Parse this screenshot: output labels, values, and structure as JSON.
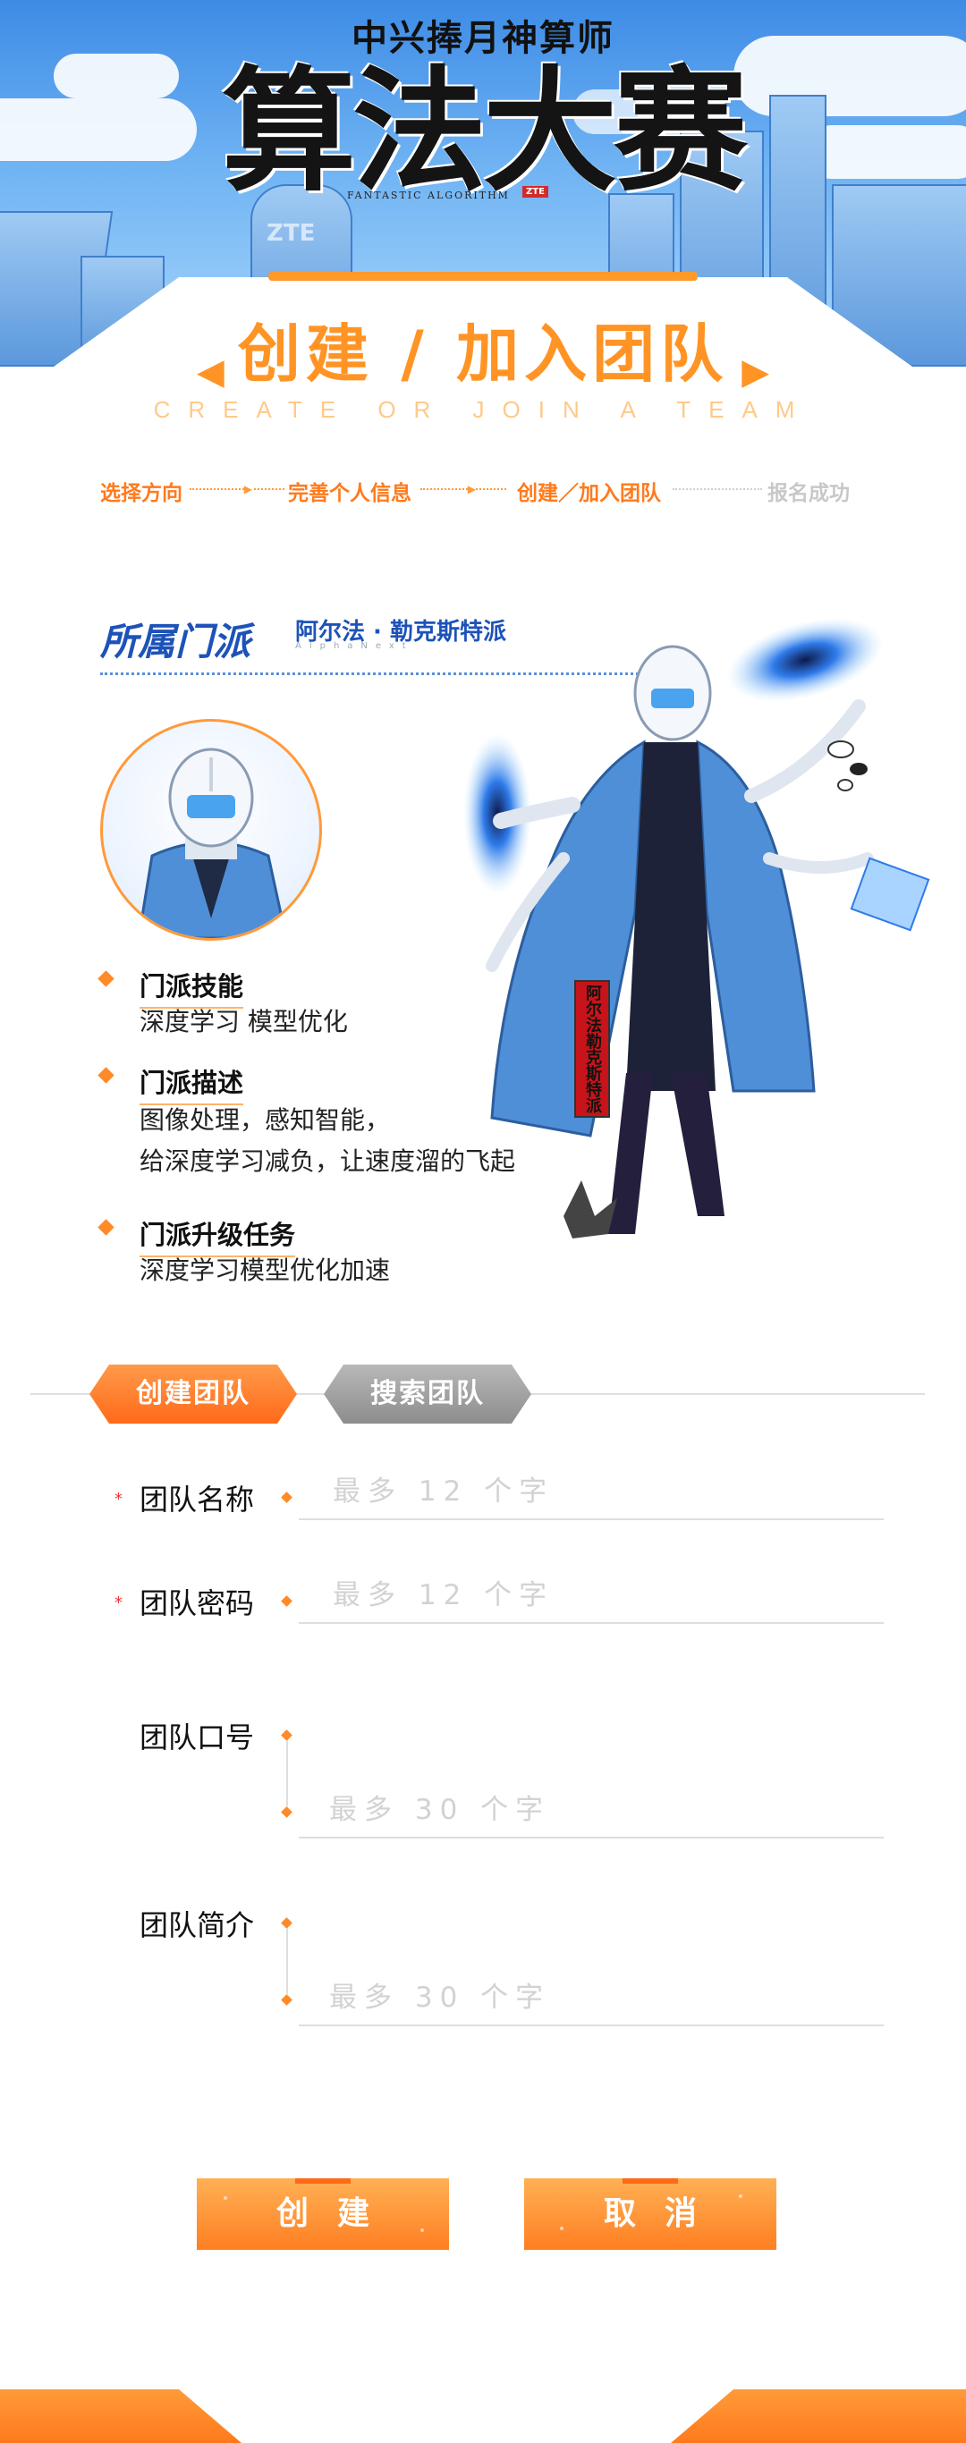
{
  "banner": {
    "logo_top": "中兴捧月神算师",
    "logo_main": "算法大赛",
    "logo_sub": "FANTASTIC ALGORITHM",
    "logo_brand": "ZTE",
    "building_brand": "ZTE"
  },
  "header": {
    "title": "创建 / 加入团队",
    "title_en": "CREATE OR JOIN A TEAM"
  },
  "steps": [
    {
      "label": "选择方向",
      "state": "done"
    },
    {
      "label": "完善个人信息",
      "state": "done"
    },
    {
      "label": "创建／加入团队",
      "state": "current"
    },
    {
      "label": "报名成功",
      "state": "todo"
    }
  ],
  "faction": {
    "heading": "所属门派",
    "name": "阿尔法 · 勒克斯特派",
    "name_en": "AlphaNext",
    "ribbon": "阿尔法勒克斯特派",
    "attributes": [
      {
        "label": "门派技能",
        "lines": [
          "深度学习 模型优化"
        ]
      },
      {
        "label": "门派描述",
        "lines": [
          "图像处理，感知智能，",
          "给深度学习减负，让速度溜的飞起"
        ]
      },
      {
        "label": "门派升级任务",
        "lines": [
          "深度学习模型优化加速"
        ]
      }
    ]
  },
  "tabs": {
    "create": "创建团队",
    "search": "搜索团队",
    "active": "create"
  },
  "form": {
    "team_name": {
      "label": "团队名称",
      "required": "*",
      "placeholder": "最多 12 个字",
      "value": ""
    },
    "team_password": {
      "label": "团队密码",
      "required": "*",
      "placeholder": "最多 12 个字",
      "value": ""
    },
    "team_slogan": {
      "label": "团队口号",
      "placeholder": "最多 30 个字",
      "value": ""
    },
    "team_intro": {
      "label": "团队简介",
      "placeholder": "最多 30 个字",
      "value": ""
    }
  },
  "actions": {
    "create": "创建",
    "cancel": "取消"
  },
  "colors": {
    "accent": "#ff9425",
    "accent_dark": "#ff6a1a",
    "faction_blue": "#1d53b8",
    "inactive": "#c8c8c8"
  }
}
